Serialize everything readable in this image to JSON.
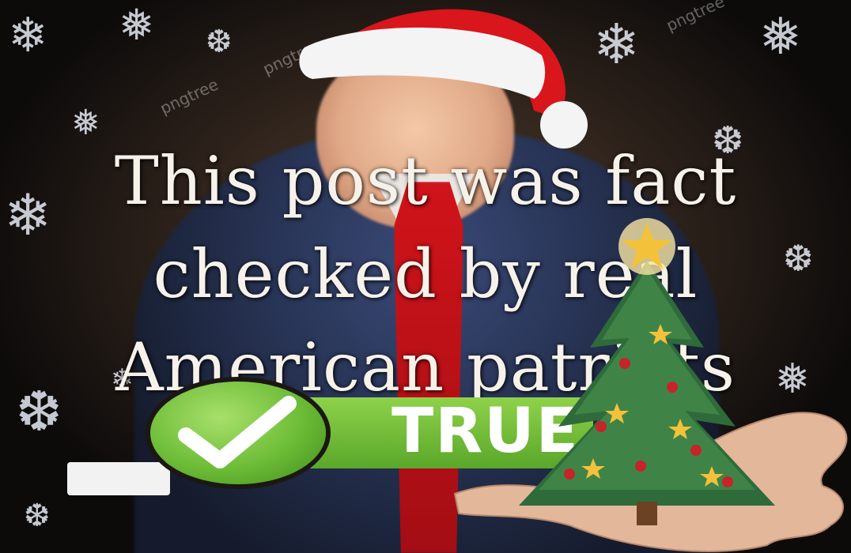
{
  "meme": {
    "caption_lines": [
      "This post was fact",
      "checked by real",
      "American patriots"
    ],
    "badge_label": "TRUE",
    "watermark": "pngtree"
  },
  "icons": {
    "check": "checkmark-icon",
    "snowflake": "snowflake-icon",
    "star": "star-icon"
  },
  "colors": {
    "caption": "#f6f2ea",
    "badge_green": "#6cbc36",
    "tie_red": "#d0141a",
    "hat_red": "#d8161c",
    "tree_green": "#2f6b3a"
  }
}
